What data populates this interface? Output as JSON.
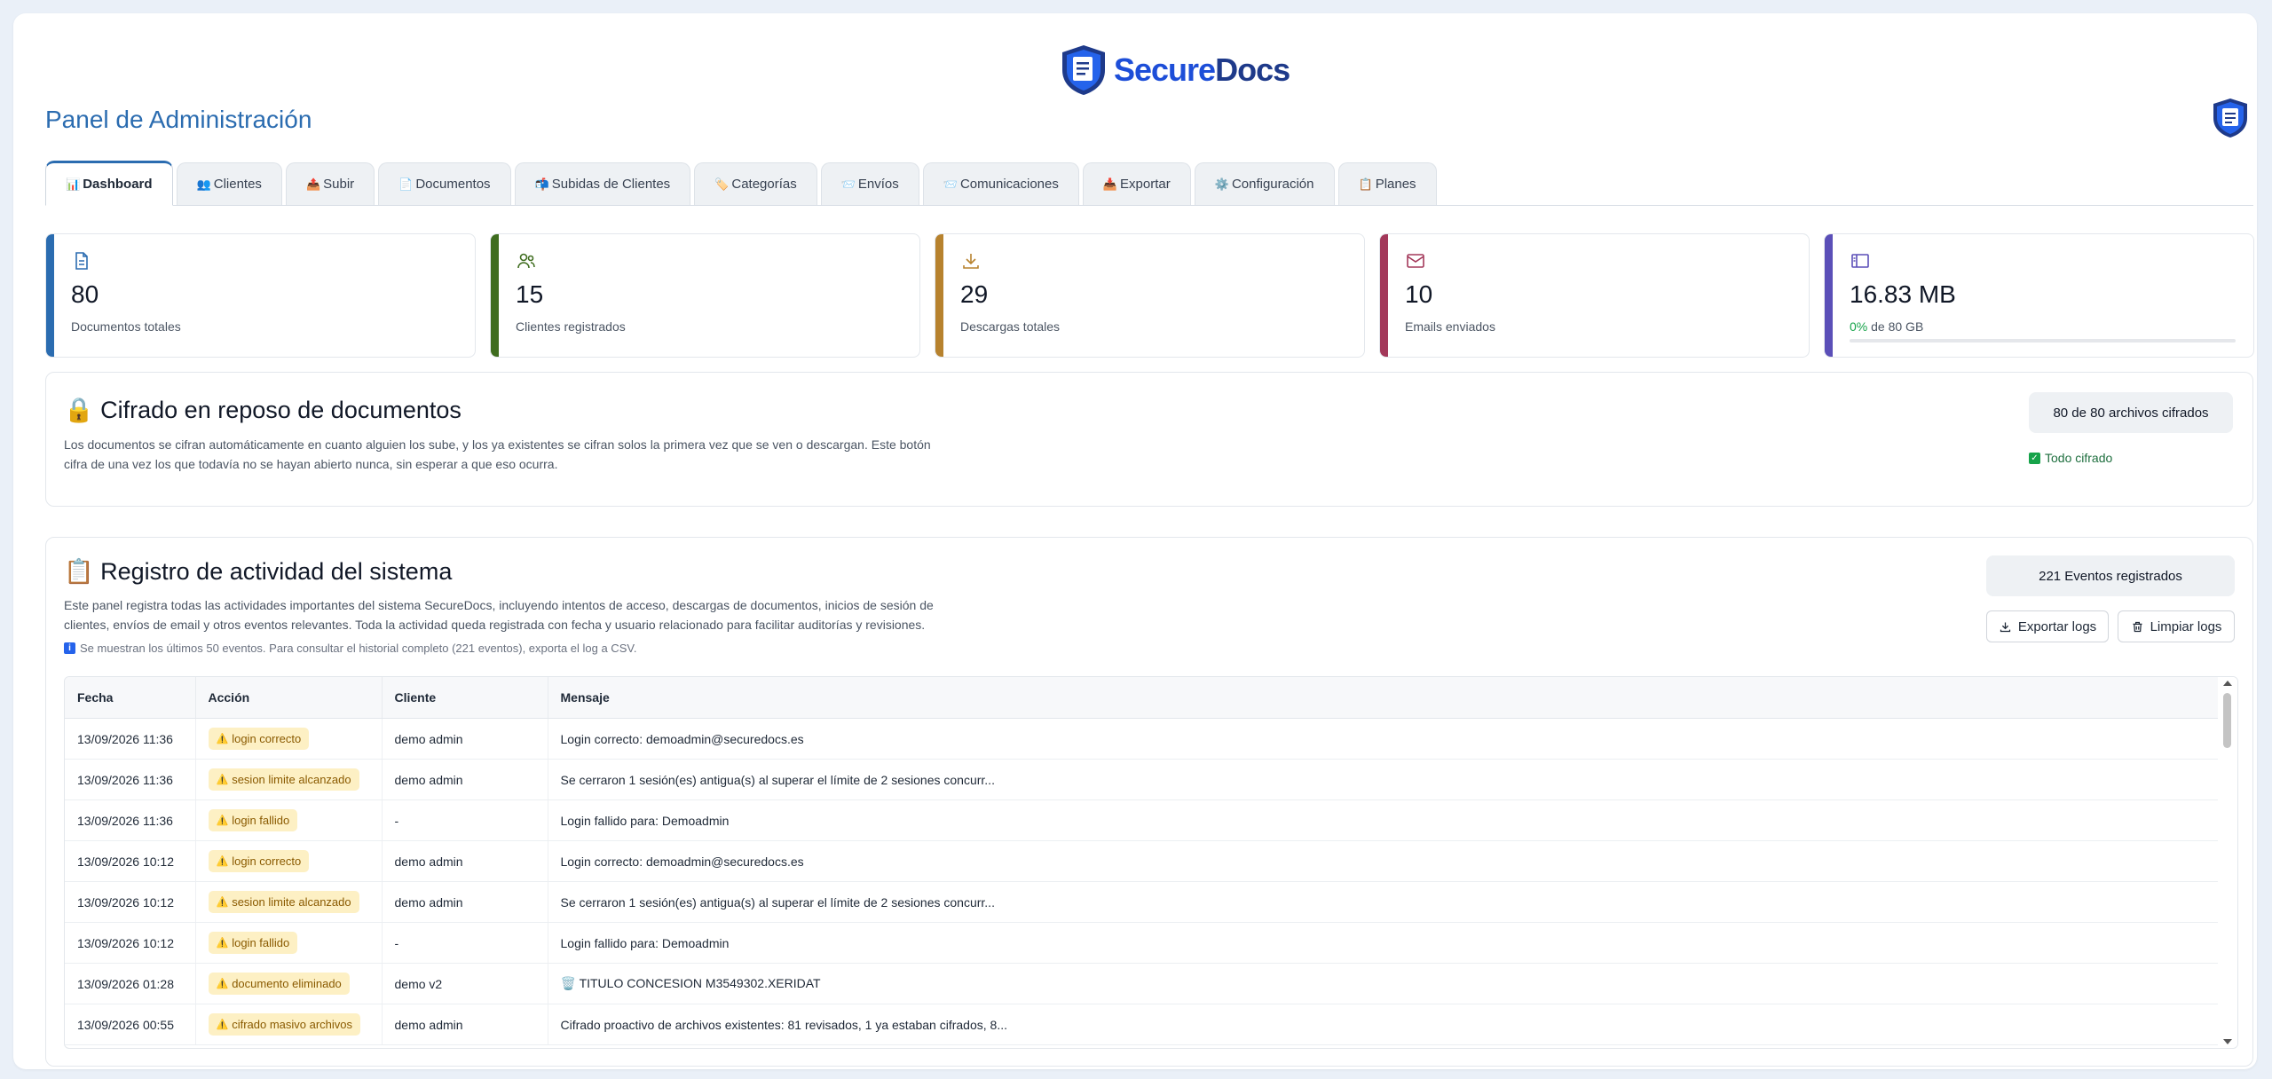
{
  "brand": {
    "name_part1": "Secure",
    "name_part2": "Docs"
  },
  "page_title": "Panel de Administración",
  "tabs": [
    {
      "icon": "📊",
      "label": "Dashboard",
      "active": true
    },
    {
      "icon": "👥",
      "label": "Clientes"
    },
    {
      "icon": "📤",
      "label": "Subir"
    },
    {
      "icon": "📄",
      "label": "Documentos"
    },
    {
      "icon": "📬",
      "label": "Subidas de Clientes"
    },
    {
      "icon": "🏷️",
      "label": "Categorías"
    },
    {
      "icon": "📨",
      "label": "Envíos"
    },
    {
      "icon": "📨",
      "label": "Comunicaciones"
    },
    {
      "icon": "📥",
      "label": "Exportar"
    },
    {
      "icon": "⚙️",
      "label": "Configuración"
    },
    {
      "icon": "📋",
      "label": "Planes"
    }
  ],
  "stats": [
    {
      "value": "80",
      "label": "Documentos totales",
      "color": "#2b6cb0",
      "icon": "document-icon"
    },
    {
      "value": "15",
      "label": "Clientes registrados",
      "color": "#3f6d1f",
      "icon": "users-icon"
    },
    {
      "value": "29",
      "label": "Descargas totales",
      "color": "#b7822e",
      "icon": "download-icon"
    },
    {
      "value": "10",
      "label": "Emails enviados",
      "color": "#a3385a",
      "icon": "mail-icon"
    },
    {
      "value": "16.83 MB",
      "label_highlight": "0%",
      "label_rest": " de 80 GB",
      "color": "#5b4fb8",
      "icon": "storage-icon",
      "progress": 0.0
    }
  ],
  "encryption": {
    "title": "Cifrado en reposo de documentos",
    "description": "Los documentos se cifran automáticamente en cuanto alguien los sube, y los ya existentes se cifran solos la primera vez que se ven o descargan. Este botón cifra de una vez los que todavía no se hayan abierto nunca, sin esperar a que eso ocurra.",
    "count_label": "80 de 80 archivos cifrados",
    "status_label": "Todo cifrado"
  },
  "activity": {
    "title": "Registro de actividad del sistema",
    "description": "Este panel registra todas las actividades importantes del sistema SecureDocs, incluyendo intentos de acceso, descargas de documentos, inicios de sesión de clientes, envíos de email y otros eventos relevantes. Toda la actividad queda registrada con fecha y usuario relacionado para facilitar auditorías y revisiones.",
    "note": "Se muestran los últimos 50 eventos. Para consultar el historial completo (221 eventos), exporta el log a CSV.",
    "events_label": "221 Eventos registrados",
    "export_label": "Exportar logs",
    "clear_label": "Limpiar logs",
    "columns": [
      "Fecha",
      "Acción",
      "Cliente",
      "Mensaje"
    ],
    "rows": [
      {
        "fecha": "13/09/2026 11:36",
        "accion": "login correcto",
        "cliente": "demo admin",
        "mensaje": "Login correcto: demoadmin@securedocs.es"
      },
      {
        "fecha": "13/09/2026 11:36",
        "accion": "sesion limite alcanzado",
        "cliente": "demo admin",
        "mensaje": "Se cerraron 1 sesión(es) antigua(s) al superar el límite de 2 sesiones concurr..."
      },
      {
        "fecha": "13/09/2026 11:36",
        "accion": "login fallido",
        "cliente": "-",
        "mensaje": "Login fallido para: Demoadmin"
      },
      {
        "fecha": "13/09/2026 10:12",
        "accion": "login correcto",
        "cliente": "demo admin",
        "mensaje": "Login correcto: demoadmin@securedocs.es"
      },
      {
        "fecha": "13/09/2026 10:12",
        "accion": "sesion limite alcanzado",
        "cliente": "demo admin",
        "mensaje": "Se cerraron 1 sesión(es) antigua(s) al superar el límite de 2 sesiones concurr..."
      },
      {
        "fecha": "13/09/2026 10:12",
        "accion": "login fallido",
        "cliente": "-",
        "mensaje": "Login fallido para: Demoadmin"
      },
      {
        "fecha": "13/09/2026 01:28",
        "accion": "documento eliminado",
        "cliente": "demo v2",
        "mensaje": "🗑️ TITULO CONCESION M3549302.XERIDAT"
      },
      {
        "fecha": "13/09/2026 00:55",
        "accion": "cifrado masivo archivos",
        "cliente": "demo admin",
        "mensaje": "Cifrado proactivo de archivos existentes: 81 revisados, 1 ya estaban cifrados, 8..."
      }
    ]
  }
}
